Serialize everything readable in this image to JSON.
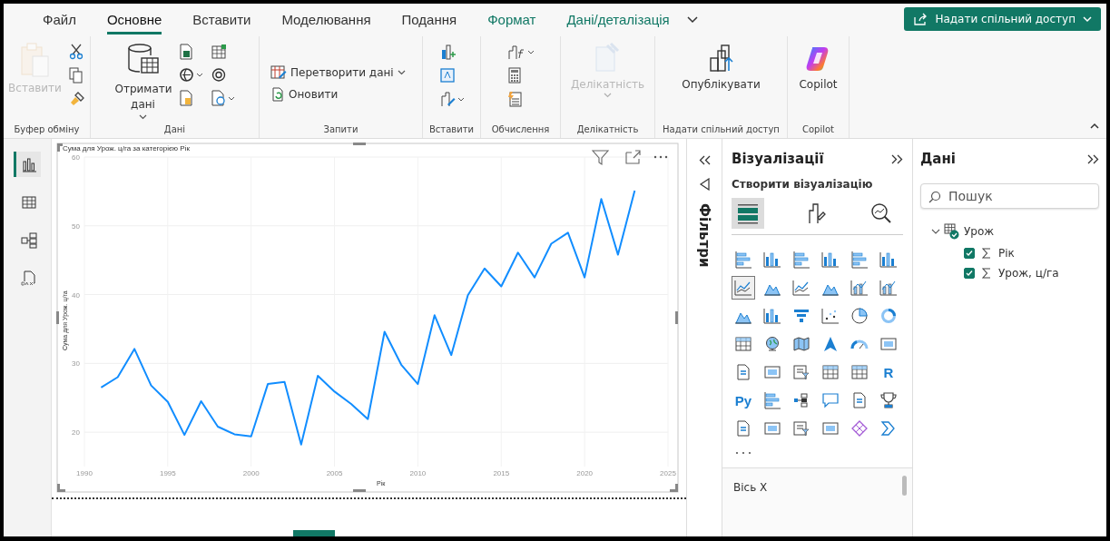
{
  "tabs": [
    {
      "label": "Файл",
      "selected": false,
      "kind": "normal"
    },
    {
      "label": "Основне",
      "selected": true,
      "kind": "normal"
    },
    {
      "label": "Вставити",
      "selected": false,
      "kind": "normal"
    },
    {
      "label": "Моделювання",
      "selected": false,
      "kind": "normal"
    },
    {
      "label": "Подання",
      "selected": false,
      "kind": "normal"
    },
    {
      "label": "Формат",
      "selected": false,
      "kind": "contextual"
    },
    {
      "label": "Дані/деталізація",
      "selected": false,
      "kind": "contextual"
    }
  ],
  "share_button": {
    "label": "Надати спільний доступ"
  },
  "ribbon": {
    "groups": [
      {
        "label": "Буфер обміну",
        "buttons": [
          {
            "label": "Вставити",
            "kind": "large",
            "disabled": true,
            "dropdown": false
          }
        ]
      },
      {
        "label": "Дані",
        "buttons": [
          {
            "label": "Отримати дані",
            "kind": "large",
            "disabled": false,
            "dropdown": true
          }
        ]
      },
      {
        "label": "Запити",
        "buttons": [
          {
            "label": "Перетворити дані",
            "kind": "small",
            "disabled": false,
            "dropdown": true
          },
          {
            "label": "Оновити",
            "kind": "small",
            "disabled": false,
            "dropdown": false
          }
        ]
      },
      {
        "label": "Вставити"
      },
      {
        "label": "Обчислення"
      },
      {
        "label": "Делікатність",
        "buttons": [
          {
            "label": "Делікатність",
            "kind": "large",
            "disabled": true,
            "dropdown": true
          }
        ]
      },
      {
        "label": "Надати спільний доступ",
        "buttons": [
          {
            "label": "Опублікувати",
            "kind": "large",
            "disabled": false,
            "dropdown": false
          }
        ]
      },
      {
        "label": "Copilot",
        "buttons": [
          {
            "label": "Copilot",
            "kind": "large",
            "disabled": false,
            "dropdown": false
          }
        ]
      }
    ]
  },
  "view_rail": [
    {
      "selected": true
    },
    {
      "selected": false
    },
    {
      "selected": false
    },
    {
      "selected": false
    }
  ],
  "visual": {
    "chart_data": {
      "type": "line",
      "title": "Сума для Урож. ц/га за категорією Рік",
      "xlabel": "Рік",
      "ylabel": "Сума для Урож. ц/га",
      "x": [
        1991,
        1992,
        1993,
        1994,
        1995,
        1996,
        1997,
        1998,
        1999,
        2000,
        2001,
        2002,
        2003,
        2004,
        2005,
        2006,
        2007,
        2008,
        2009,
        2010,
        2011,
        2012,
        2013,
        2014,
        2015,
        2016,
        2017,
        2018,
        2019,
        2020,
        2021,
        2022,
        2023
      ],
      "series": [
        {
          "color": "#118dff",
          "values": [
            26.5,
            28.0,
            32.1,
            26.8,
            24.4,
            19.6,
            24.5,
            20.8,
            19.7,
            19.4,
            27.0,
            27.3,
            18.2,
            28.2,
            25.9,
            24.1,
            21.9,
            34.6,
            29.8,
            27.0,
            37.0,
            31.2,
            39.9,
            43.8,
            41.2,
            46.1,
            42.5,
            47.4,
            49.0,
            42.5,
            53.9,
            45.8,
            55.1
          ]
        }
      ],
      "xlim": [
        1990,
        2025
      ],
      "ylim": [
        15,
        60
      ],
      "xticks": [
        1990,
        1995,
        2000,
        2005,
        2010,
        2015,
        2020,
        2025
      ],
      "yticks": [
        20,
        30,
        40,
        50,
        60
      ],
      "grid": true
    }
  },
  "filters": {
    "label": "Фільтри"
  },
  "visualizations": {
    "title": "Візуалізації",
    "subtitle": "Створити візуалізацію",
    "build_tabs": [
      {
        "selected": true
      },
      {
        "selected": false
      },
      {
        "selected": false
      }
    ],
    "visual_types": [
      {
        "kind": "icon",
        "selected": false
      },
      {
        "kind": "icon",
        "selected": false
      },
      {
        "kind": "icon",
        "selected": false
      },
      {
        "kind": "icon",
        "selected": false
      },
      {
        "kind": "icon",
        "selected": false
      },
      {
        "kind": "icon",
        "selected": false
      },
      {
        "kind": "icon",
        "selected": true
      },
      {
        "kind": "icon",
        "selected": false
      },
      {
        "kind": "icon",
        "selected": false
      },
      {
        "kind": "icon",
        "selected": false
      },
      {
        "kind": "icon",
        "selected": false
      },
      {
        "kind": "icon",
        "selected": false
      },
      {
        "kind": "icon",
        "selected": false
      },
      {
        "kind": "icon",
        "selected": false
      },
      {
        "kind": "icon",
        "selected": false
      },
      {
        "kind": "icon",
        "selected": false
      },
      {
        "kind": "icon",
        "selected": false
      },
      {
        "kind": "icon",
        "selected": false
      },
      {
        "kind": "icon",
        "selected": false
      },
      {
        "kind": "icon",
        "selected": false
      },
      {
        "kind": "icon",
        "selected": false
      },
      {
        "kind": "icon",
        "selected": false
      },
      {
        "kind": "icon",
        "selected": false
      },
      {
        "kind": "icon",
        "selected": false
      },
      {
        "kind": "icon",
        "selected": false
      },
      {
        "kind": "icon",
        "selected": false
      },
      {
        "kind": "icon",
        "selected": false
      },
      {
        "kind": "icon",
        "selected": false
      },
      {
        "kind": "icon",
        "selected": false
      },
      {
        "kind": "text",
        "text": "R",
        "selected": false
      },
      {
        "kind": "text",
        "text": "Py",
        "selected": false
      },
      {
        "kind": "icon",
        "selected": false
      },
      {
        "kind": "icon",
        "selected": false
      },
      {
        "kind": "icon",
        "selected": false
      },
      {
        "kind": "icon",
        "selected": false
      },
      {
        "kind": "icon",
        "selected": false
      },
      {
        "kind": "icon",
        "selected": false
      },
      {
        "kind": "icon",
        "selected": false
      },
      {
        "kind": "icon",
        "selected": false
      },
      {
        "kind": "icon",
        "selected": false
      },
      {
        "kind": "icon",
        "selected": false
      },
      {
        "kind": "icon",
        "selected": false
      }
    ],
    "section": "Вісь X"
  },
  "data": {
    "title": "Дані",
    "search": {
      "placeholder": "Пошук"
    },
    "tree": [
      {
        "label": "Урож",
        "expanded": true,
        "children": [
          {
            "label": "Рік",
            "checked": true
          },
          {
            "label": "Урож, ц/га",
            "checked": true
          }
        ]
      }
    ]
  }
}
